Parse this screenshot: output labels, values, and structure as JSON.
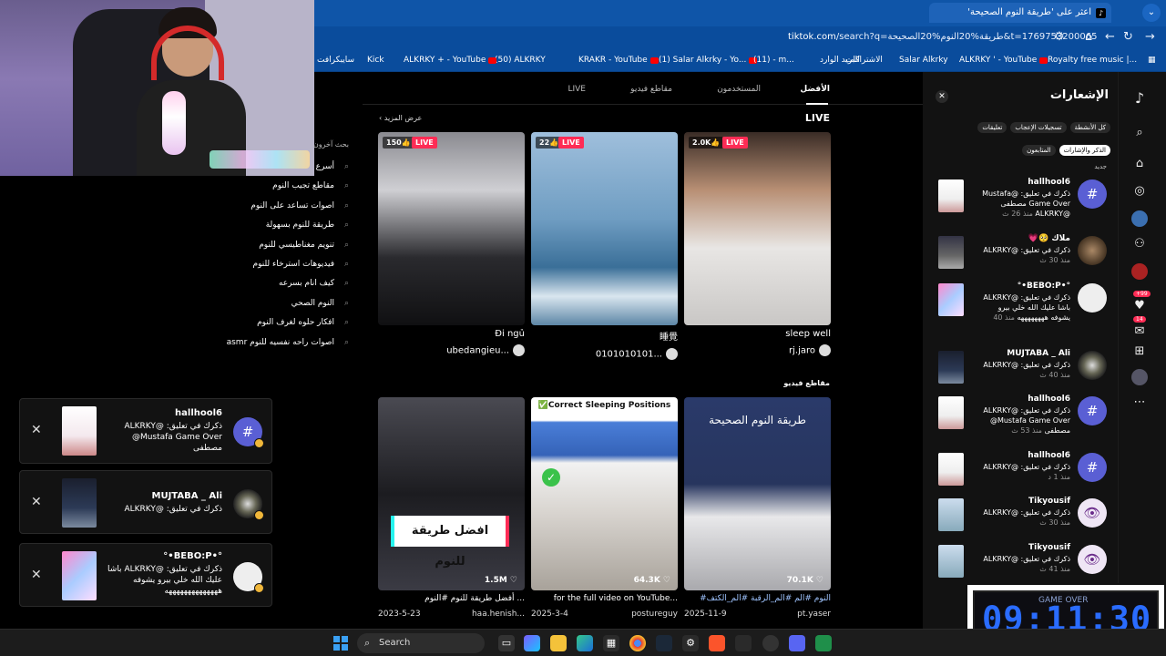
{
  "browser": {
    "tab_title": "اعثر على 'طريقة النوم الصحيحة'",
    "tab_favicon": "tiktok-icon",
    "new_tab": "+",
    "tab_close": "×",
    "tab_menu": "⌄",
    "url_host": "tiktok.com",
    "url_rest": "/search?q=طريقة%20النوم%20الصحيحة&t=1769753200065",
    "bookmarks": [
      "Royalty free music |...",
      "KRAKR - YouTube",
      "(1) Salar Alkrky - Yo...",
      "(11) - m...",
      "البريد الوارد",
      "الاشتراكات",
      "Salar Alkrky",
      "ALKRKY ' - YouTube",
      "(50) ALKRKY",
      "ALKRKY + - YouTube",
      "Kick",
      "سايبكرافت"
    ]
  },
  "related": {
    "header": "بحث آخرون",
    "items": [
      "أسرع",
      "مقاطع تجيب النوم",
      "اصوات تساعد على النوم",
      "طريقة للنوم بسهولة",
      "تنويم مغناطيسي للنوم",
      "فيديوهات استرخاء للنوم",
      "كيف انام بسرعه",
      "النوم الصحي",
      "افكار حلوه لغرف النوم",
      "اصوات راحه نفسيه للنوم asmr"
    ]
  },
  "toasts": [
    {
      "name": "hallhool6",
      "text": "ذكرك في تعليق: @ALKRKY @Mustafa Game Over مصطفى",
      "avatar": "#"
    },
    {
      "name": "MUJTABA _ Ali",
      "text": "ذكرك في تعليق: @ALKRKY",
      "avatar": ""
    },
    {
      "name": "°•BEBO:P•°",
      "text": "ذكرك في تعليق: @ALKRKY باشا عليك الله خلي بيرو يشوفه ههههههههههههههه",
      "avatar": ""
    }
  ],
  "search": {
    "tabs": [
      "الأفضل",
      "المستخدمون",
      "مقاطع فيديو",
      "LIVE"
    ],
    "live_title": "LIVE",
    "see_all": "عرض المزيد",
    "videos_title": "مقاطع فيديو",
    "live": [
      {
        "count": "150",
        "badge": "LIVE",
        "title": "Đi ngủ",
        "user": "ubedangieu..."
      },
      {
        "count": "22",
        "badge": "LIVE",
        "title": "睡覺",
        "user": "0101010101..."
      },
      {
        "count": "2.0K",
        "badge": "LIVE",
        "title": "sleep well",
        "user": "rj.jaro"
      }
    ],
    "videos": [
      {
        "likes": "1.5M ♡",
        "overlay": "افضل طريقة للنوم",
        "caption": "أفضل طريقة للنوم #النوم ...",
        "date": "2023-5-23",
        "user": "haa.henish..."
      },
      {
        "likes": "64.3K ♡",
        "overlay": "✅Correct Sleeping Positions",
        "caption": "for the full video on YouTube...",
        "date": "2025-3-4",
        "user": "postureguy"
      },
      {
        "likes": "70.1K ♡",
        "overlay": "طريقة النوم الصحيحة",
        "caption": "#النوم #الم #الم_الرقبة #الم_الكتف",
        "date": "2025-11-9",
        "user": "pt.yaser"
      }
    ]
  },
  "notifications": {
    "title": "الإشعارات",
    "chips": [
      "كل الأنشطة",
      "تسجيلات الإعجاب",
      "تعليقات",
      "الذكر والإشارات",
      "المتابعون"
    ],
    "new_label": "جديد",
    "items": [
      {
        "name": "hallhool6",
        "text": "ذكرك في تعليق: @Mustafa Game Over مصطفى @ALKRKY",
        "time": "منذ 26 ث",
        "avatar": "#"
      },
      {
        "name": "ملاك 🥺💗",
        "text": "ذكرك في تعليق: @ALKRKY",
        "time": "منذ 30 ث",
        "avatar": ""
      },
      {
        "name": "°•BEBO:P•°",
        "text": "ذكرك في تعليق: @ALKRKY باشا عليك الله خلي بيرو يشوفه ههههههههه",
        "time": "منذ 40",
        "avatar": ""
      },
      {
        "name": "MUJTABA _ Ali",
        "text": "ذكرك في تعليق: @ALKRKY",
        "time": "منذ 40 ث",
        "avatar": ""
      },
      {
        "name": "hallhool6",
        "text": "ذكرك في تعليق: @ALKRKY @Mustafa Game Over مصطفى",
        "time": "منذ 53 ث",
        "avatar": "#"
      },
      {
        "name": "hallhool6",
        "text": "ذكرك في تعليق: @ALKRKY",
        "time": "منذ 1 د",
        "avatar": "#"
      },
      {
        "name": "Tikyousif",
        "text": "ذكرك في تعليق: @ALKRKY",
        "time": "منذ 30 ث",
        "avatar": "👁"
      },
      {
        "name": "Tikyousif",
        "text": "ذكرك في تعليق: @ALKRKY",
        "time": "منذ 41 ث",
        "avatar": "👁"
      }
    ]
  },
  "rail": {
    "badge1": "+99",
    "badge2": "14"
  },
  "clock": {
    "time": "09:11:30",
    "pre": "GAME OVER"
  },
  "taskbar": {
    "search": "Search"
  },
  "colors": {
    "accent": "#fe2c55",
    "hashtag_av": "#5a5fd4",
    "browser": "#0a4c9c",
    "clock": "#2a6cff"
  }
}
